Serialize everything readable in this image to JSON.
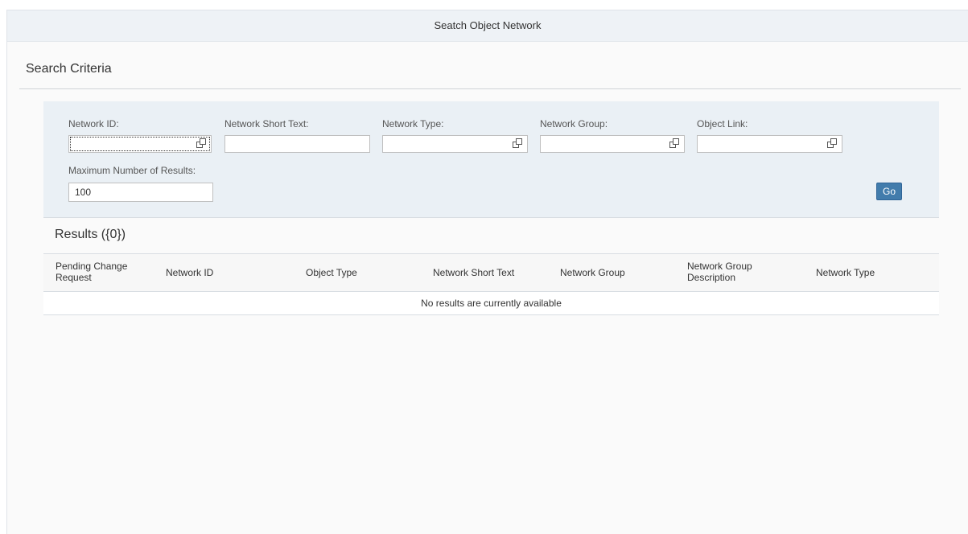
{
  "window": {
    "title": "Seatch Object Network"
  },
  "search_criteria": {
    "title": "Search Criteria",
    "fields": {
      "network_id": {
        "label": "Network ID:",
        "value": ""
      },
      "network_short_text": {
        "label": "Network Short Text:",
        "value": ""
      },
      "network_type": {
        "label": "Network Type:",
        "value": ""
      },
      "network_group": {
        "label": "Network Group:",
        "value": ""
      },
      "object_link": {
        "label": "Object Link:",
        "value": ""
      },
      "max_results": {
        "label": "Maximum Number of Results:",
        "value": "100"
      }
    },
    "go_label": "Go",
    "value_help_icon": "value-help-icon"
  },
  "results": {
    "title": "Results ({0})",
    "columns": {
      "pending_change_request": [
        "Pending Change",
        "Request"
      ],
      "network_id": "Network ID",
      "object_type": "Object Type",
      "network_short_text": "Network Short Text",
      "network_group": "Network Group",
      "network_group_description": [
        "Network Group",
        "Description"
      ],
      "network_type": "Network Type"
    },
    "empty_text": "No results are currently available"
  },
  "colors": {
    "accent": "#427cac",
    "panel": "#eaf0f5",
    "title_bar": "#eef2f6"
  }
}
